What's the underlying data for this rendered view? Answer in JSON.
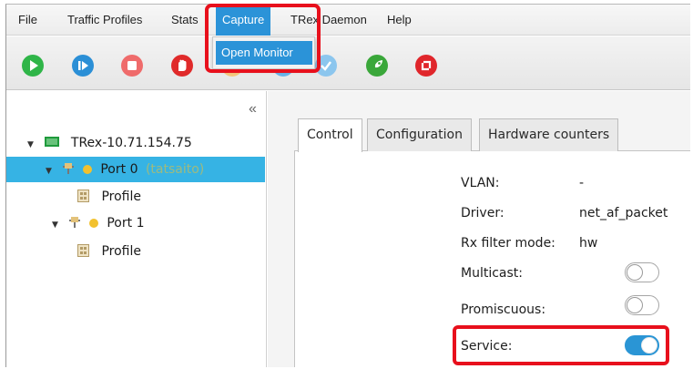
{
  "menu": {
    "file": "File",
    "traffic_profiles": "Traffic Profiles",
    "stats": "Stats",
    "capture": "Capture",
    "trex_daemon": "TRex Daemon",
    "help": "Help"
  },
  "capture_menu": {
    "open_monitor": "Open Monitor"
  },
  "toolbar_icons": [
    {
      "name": "play-icon",
      "color": "#2fb548"
    },
    {
      "name": "step-icon",
      "color": "#2b8fd6"
    },
    {
      "name": "stop-icon",
      "color": "#ef6b6b"
    },
    {
      "name": "hand-icon",
      "color": "#e02a2a"
    },
    {
      "name": "rocket-icon",
      "color": "#3aa73a"
    },
    {
      "name": "reset-icon",
      "color": "#e0262b"
    }
  ],
  "sidebar": {
    "collapse": "«",
    "server": "TRex-10.71.154.75",
    "port0": "Port 0",
    "port0_owner": "(tatsaito)",
    "port0_profile": "Profile",
    "port1": "Port 1",
    "port1_profile": "Profile"
  },
  "tabs": {
    "control": "Control",
    "configuration": "Configuration",
    "hardware_counters": "Hardware counters"
  },
  "control": {
    "vlan_label": "VLAN:",
    "vlan_value": "-",
    "driver_label": "Driver:",
    "driver_value": "net_af_packet",
    "rx_filter_label": "Rx filter mode:",
    "rx_filter_value": "hw",
    "multicast_label": "Multicast:",
    "multicast_on": false,
    "promiscuous_label": "Promiscuous:",
    "promiscuous_on": false,
    "service_label": "Service:",
    "service_on": true
  },
  "colors": {
    "accent": "#2b93d8",
    "selection": "#36b3e4",
    "highlight": "#e8101c",
    "port_dot": "#f2c12e"
  }
}
